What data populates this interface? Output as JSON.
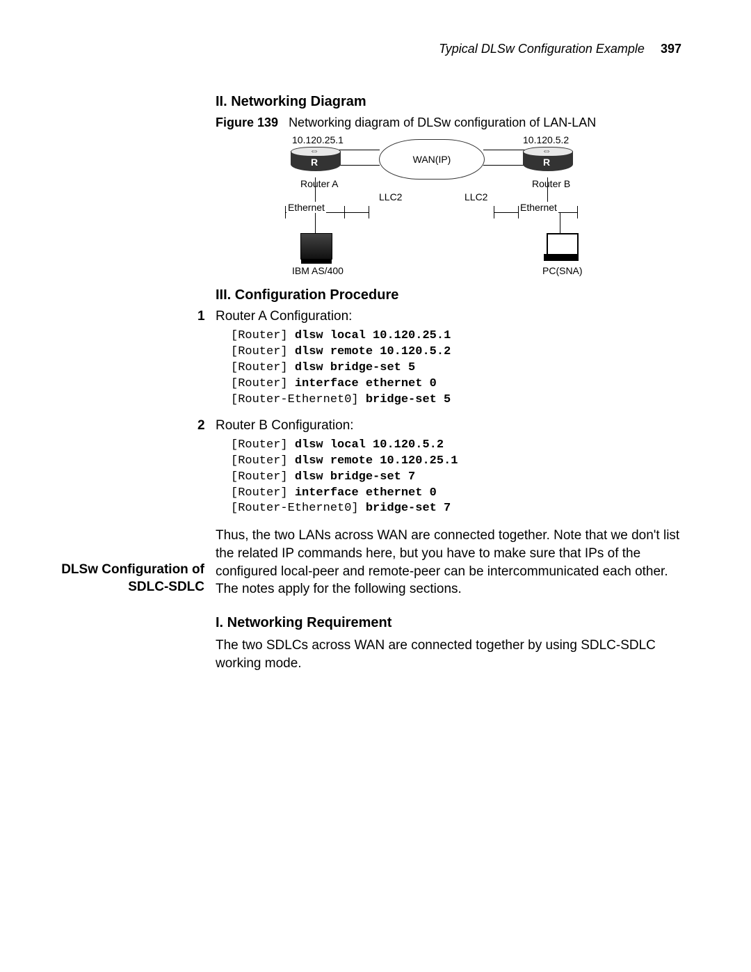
{
  "header": {
    "title": "Typical DLSw Configuration Example",
    "page_number": "397"
  },
  "section_ii": {
    "heading": "II. Networking Diagram",
    "figure_label": "Figure 139",
    "figure_caption": "Networking diagram of DLSw configuration of LAN-LAN",
    "diagram": {
      "ip_left": "10.120.25.1",
      "ip_right": "10.120.5.2",
      "cloud_label": "WAN(IP)",
      "router_a": "Router A",
      "router_b": "Router B",
      "llc2_left": "LLC2",
      "llc2_right": "LLC2",
      "ethernet_left": "Ethernet",
      "ethernet_right": "Ethernet",
      "host_left_label": "IBM AS/400",
      "host_right_label": "PC(SNA)"
    }
  },
  "section_iii": {
    "heading": "III. Configuration Procedure",
    "steps": {
      "s1_num": "1",
      "s1_title": "Router A Configuration:",
      "s1_lines": [
        {
          "prompt": "[Router] ",
          "cmd": "dlsw local 10.120.25.1"
        },
        {
          "prompt": "[Router] ",
          "cmd": "dlsw remote 10.120.5.2"
        },
        {
          "prompt": "[Router] ",
          "cmd": "dlsw bridge-set 5"
        },
        {
          "prompt": "[Router] ",
          "cmd": "interface ethernet 0"
        },
        {
          "prompt": "[Router-Ethernet0] ",
          "cmd": "bridge-set 5"
        }
      ],
      "s2_num": "2",
      "s2_title": "Router B Configuration:",
      "s2_lines": [
        {
          "prompt": "[Router] ",
          "cmd": "dlsw local 10.120.5.2"
        },
        {
          "prompt": "[Router] ",
          "cmd": "dlsw remote 10.120.25.1"
        },
        {
          "prompt": "[Router] ",
          "cmd": "dlsw bridge-set 7"
        },
        {
          "prompt": "[Router] ",
          "cmd": "interface ethernet 0"
        },
        {
          "prompt": "[Router-Ethernet0] ",
          "cmd": "bridge-set 7"
        }
      ]
    },
    "paragraph": "Thus, the two LANs across WAN are connected together. Note that we don't list the related IP commands here, but you have to make sure that IPs of the configured local-peer and remote-peer can be intercommunicated each other. The notes apply for the following sections."
  },
  "side_section": {
    "side_heading_line1": "DLSw Configuration of",
    "side_heading_line2": "SDLC-SDLC",
    "heading": "I. Networking Requirement",
    "paragraph": "The two SDLCs across WAN are connected together by using SDLC-SDLC working mode."
  }
}
